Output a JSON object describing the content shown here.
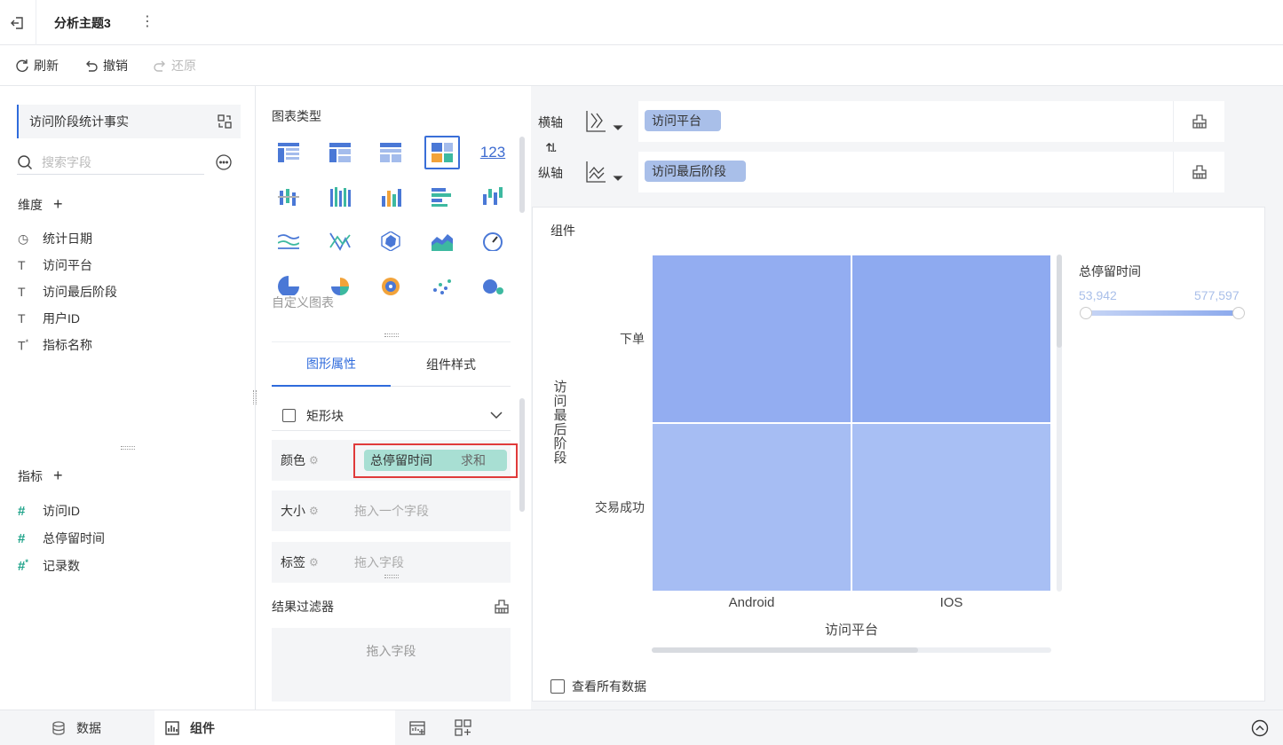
{
  "topbar": {
    "title": "分析主题3"
  },
  "toolbar": {
    "refresh": "刷新",
    "undo": "撤销",
    "redo": "还原"
  },
  "left": {
    "dataset": "访问阶段统计事实",
    "search_placeholder": "搜索字段",
    "dimensions_title": "维度",
    "dimensions": [
      {
        "icon": "clock-icon",
        "label": "统计日期"
      },
      {
        "icon": "text-icon",
        "label": "访问平台"
      },
      {
        "icon": "text-icon",
        "label": "访问最后阶段"
      },
      {
        "icon": "text-icon",
        "label": "用户ID"
      },
      {
        "icon": "text-calc-icon",
        "label": "指标名称"
      }
    ],
    "measures_title": "指标",
    "measures": [
      {
        "icon": "hash-icon",
        "label": "访问ID"
      },
      {
        "icon": "hash-icon",
        "label": "总停留时间"
      },
      {
        "icon": "hash-calc-icon",
        "label": "记录数"
      }
    ]
  },
  "mid": {
    "chart_type_label": "图表类型",
    "number_chart_label": "123",
    "custom_chart": "自定义图表",
    "tabs": [
      "图形属性",
      "组件样式"
    ],
    "shape": "矩形块",
    "props": {
      "color_label": "颜色",
      "color_field": "总停留时间",
      "color_agg": "求和",
      "size_label": "大小",
      "size_placeholder": "拖入一个字段",
      "label_label": "标签",
      "label_placeholder": "拖入字段"
    },
    "filter_title": "结果过滤器",
    "filter_placeholder": "拖入字段"
  },
  "axes": {
    "x_label": "横轴",
    "x_field": "访问平台",
    "y_label": "纵轴",
    "y_field": "访问最后阶段"
  },
  "canvas": {
    "component_name": "组件",
    "view_all": "查看所有数据"
  },
  "legend": {
    "title": "总停留时间",
    "min": "53,942",
    "max": "577,597"
  },
  "colors": {
    "accent": "#2f6bdc",
    "teal_pill": "#a8dfd3",
    "blue_pill": "#a9bfe9",
    "highlight": "#e03a3a"
  },
  "chart_data": {
    "type": "heatmap",
    "x": [
      "Android",
      "IOS"
    ],
    "y": [
      "下单",
      "交易成功"
    ],
    "xlabel": "访问平台",
    "ylabel": "访问最后阶段",
    "cells": [
      {
        "x": "Android",
        "y": "下单",
        "color": "#93adf1"
      },
      {
        "x": "IOS",
        "y": "下单",
        "color": "#8eaaf0"
      },
      {
        "x": "Android",
        "y": "交易成功",
        "color": "#a6bdf3"
      },
      {
        "x": "IOS",
        "y": "交易成功",
        "color": "#a8bff4"
      }
    ]
  },
  "bottom": {
    "data_tab": "数据",
    "component_tab": "组件"
  }
}
